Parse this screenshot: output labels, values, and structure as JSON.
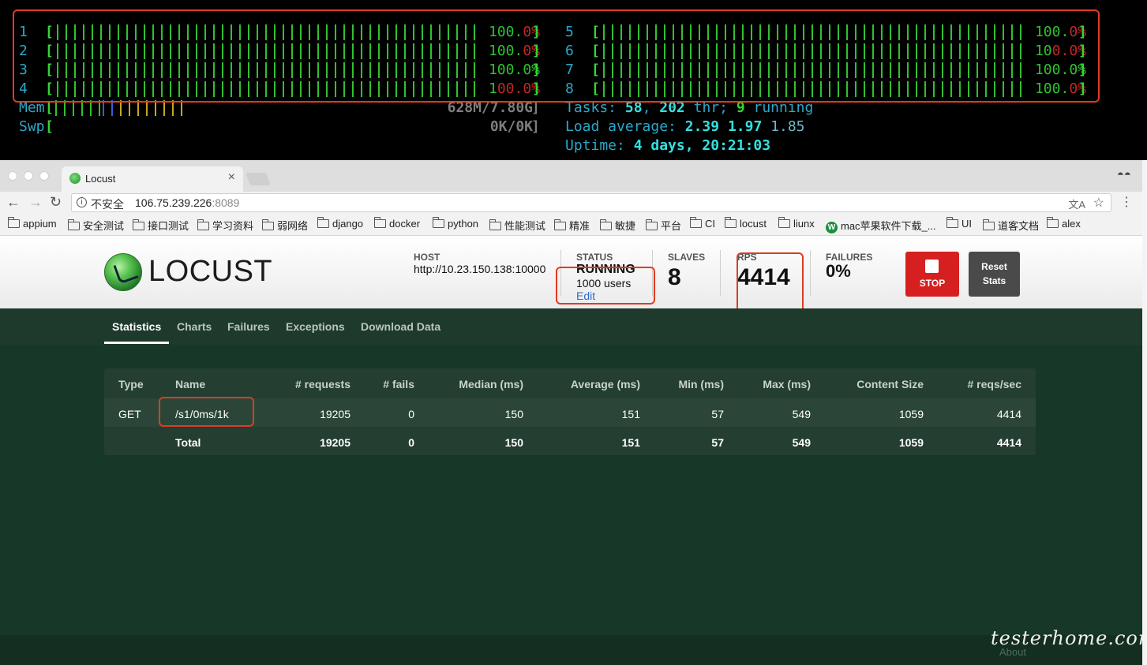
{
  "terminal": {
    "cpus": [
      {
        "id": "1",
        "pct_main": "100.",
        "pct_tail": "0%",
        "level": 1.0
      },
      {
        "id": "2",
        "pct_main": "100.",
        "pct_tail": "0%",
        "level": 1.0
      },
      {
        "id": "3",
        "pct_main": "100.0%",
        "pct_tail": "",
        "level": 1.0
      },
      {
        "id": "4",
        "pct_main": "1",
        "pct_tail": "00.0%",
        "level": 1.0
      },
      {
        "id": "5",
        "pct_main": "100.",
        "pct_tail": "0%",
        "level": 1.0
      },
      {
        "id": "6",
        "pct_main": "10",
        "pct_tail": "0.0%",
        "level": 1.0
      },
      {
        "id": "7",
        "pct_main": "100.0%",
        "pct_tail": "",
        "level": 1.0
      },
      {
        "id": "8",
        "pct_main": "100.",
        "pct_tail": "0%",
        "level": 1.0
      }
    ],
    "bracket_open": "[",
    "bracket_close": "]",
    "mem_label": "Mem",
    "mem_value": "628M/7.80G",
    "swp_label": "Swp",
    "swp_value": "0K/0K",
    "tasks_label": "Tasks:",
    "tasks_count": "58",
    "tasks_sep": ",",
    "threads_count": "202",
    "threads_label": "thr;",
    "running_count": "9",
    "running_label": "running",
    "load_label": "Load average:",
    "load_1": "2.39",
    "load_5": "1.97",
    "load_15": "1.85",
    "uptime_label": "Uptime:",
    "uptime_value": "4 days, 20:21:03",
    "colors": {
      "bar": "#2ec22e",
      "warn": "#c32626",
      "cyan": "#2aa8c9"
    }
  },
  "browser": {
    "tab_title": "Locust",
    "tab_close": "×",
    "security_label": "不安全",
    "url_host": "106.75.239.226",
    "url_port": ":8089",
    "back_icon": "←",
    "forward_icon": "→",
    "reload_icon": "↻",
    "info_icon": "i",
    "star_icon": "☆",
    "menu_icon": "⋮",
    "translate_icon": "文A",
    "incognito_icon": "◓◓",
    "bookmarks": [
      {
        "label": "appium",
        "icon": "folder-icon"
      },
      {
        "label": "安全测试",
        "icon": "folder-icon"
      },
      {
        "label": "接口测试",
        "icon": "folder-icon"
      },
      {
        "label": "学习资料",
        "icon": "folder-icon"
      },
      {
        "label": "弱网络",
        "icon": "folder-icon"
      },
      {
        "label": "django",
        "icon": "folder-icon"
      },
      {
        "label": "docker",
        "icon": "folder-icon"
      },
      {
        "label": "python",
        "icon": "folder-icon"
      },
      {
        "label": "性能测试",
        "icon": "folder-icon"
      },
      {
        "label": "精准",
        "icon": "folder-icon"
      },
      {
        "label": "敏捷",
        "icon": "folder-icon"
      },
      {
        "label": "平台",
        "icon": "folder-icon"
      },
      {
        "label": "CI",
        "icon": "folder-icon"
      },
      {
        "label": "locust",
        "icon": "folder-icon"
      },
      {
        "label": "liunx",
        "icon": "folder-icon"
      },
      {
        "label": "mac苹果软件下载_...",
        "icon": "site-icon"
      },
      {
        "label": "UI",
        "icon": "folder-icon"
      },
      {
        "label": "道客文档",
        "icon": "folder-icon"
      },
      {
        "label": "alex",
        "icon": "folder-icon"
      }
    ]
  },
  "locust": {
    "logo_text": "LOCUST",
    "host_label": "HOST",
    "host_value": "http://10.23.150.138:10000",
    "status_label": "STATUS",
    "status_value": "RUNNING",
    "users_value": "1000 users",
    "edit_label": "Edit",
    "slaves_label": "SLAVES",
    "slaves_value": "8",
    "rps_label": "RPS",
    "rps_value": "4414",
    "failures_label": "FAILURES",
    "failures_value": "0%",
    "stop_label": "STOP",
    "reset_label_1": "Reset",
    "reset_label_2": "Stats",
    "tabs": [
      "Statistics",
      "Charts",
      "Failures",
      "Exceptions",
      "Download Data"
    ],
    "table": {
      "headers": [
        "Type",
        "Name",
        "# requests",
        "# fails",
        "Median (ms)",
        "Average (ms)",
        "Min (ms)",
        "Max (ms)",
        "Content Size",
        "# reqs/sec"
      ],
      "rows": [
        [
          "GET",
          "/s1/0ms/1k",
          "19205",
          "0",
          "150",
          "151",
          "57",
          "549",
          "1059",
          "4414"
        ]
      ],
      "total": [
        "",
        "Total",
        "19205",
        "0",
        "150",
        "151",
        "57",
        "549",
        "1059",
        "4414"
      ]
    },
    "about_label": "About"
  },
  "watermark": "testerhome.com"
}
